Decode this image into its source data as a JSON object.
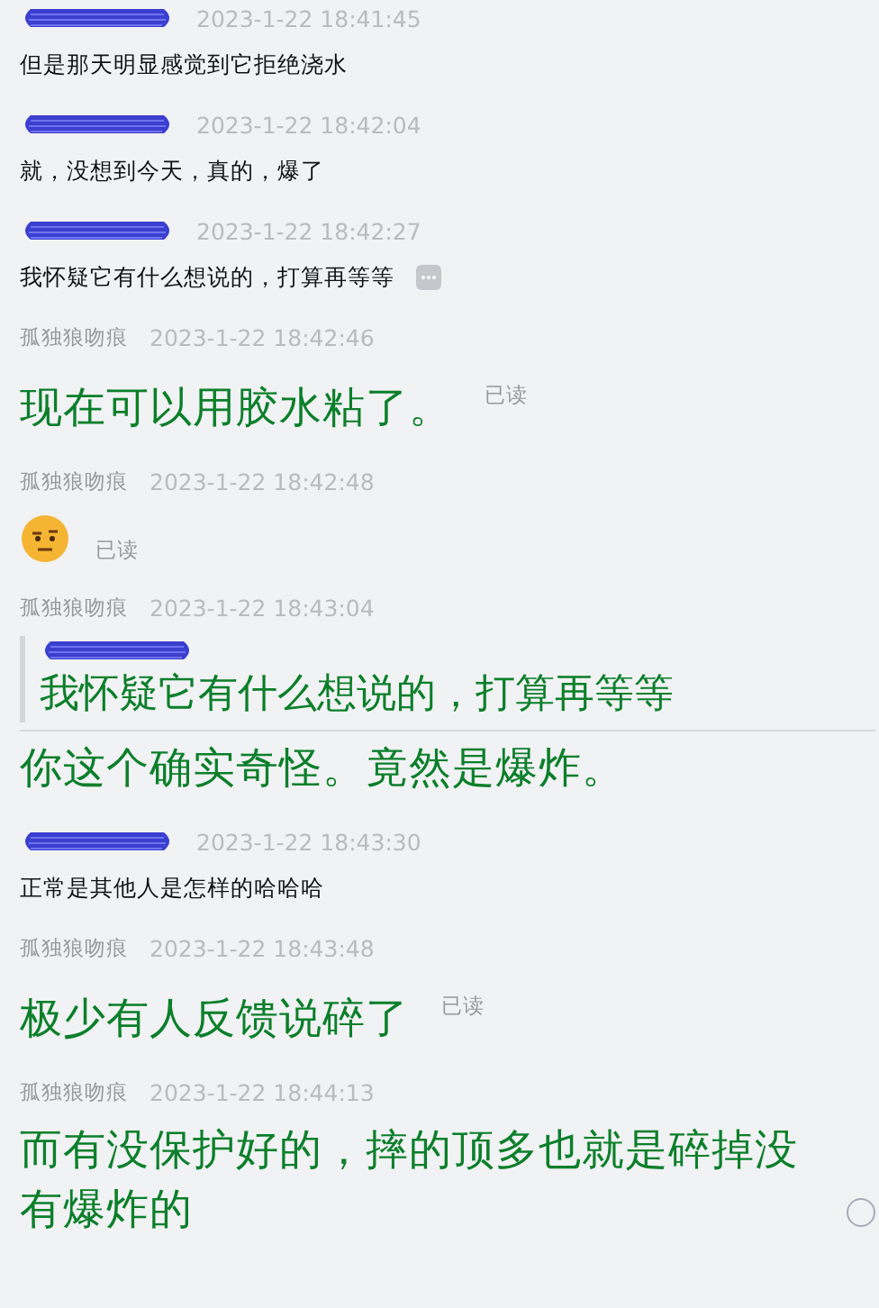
{
  "messages": [
    {
      "kind": "incoming",
      "time": "2023-1-22 18:41:45",
      "text": "但是那天明显感觉到它拒绝浇水"
    },
    {
      "kind": "incoming",
      "time": "2023-1-22 18:42:04",
      "text": "就，没想到今天，真的，爆了"
    },
    {
      "kind": "incoming",
      "time": "2023-1-22 18:42:27",
      "text": "我怀疑它有什么想说的，打算再等等",
      "more": true
    },
    {
      "kind": "outgoing",
      "sender": "孤独狼吻痕",
      "time": "2023-1-22 18:42:46",
      "text": "现在可以用胶水粘了。",
      "receipt": "已读",
      "pending": false
    },
    {
      "kind": "emoji",
      "sender": "孤独狼吻痕",
      "time": "2023-1-22 18:42:48",
      "receipt": "已读",
      "pending": false
    },
    {
      "kind": "quote",
      "sender": "孤独狼吻痕",
      "time": "2023-1-22 18:43:04",
      "quote": "我怀疑它有什么想说的，打算再等等",
      "text": "你这个确实奇怪。竟然是爆炸。",
      "pending": false
    },
    {
      "kind": "incoming",
      "time": "2023-1-22 18:43:30",
      "text": "正常是其他人是怎样的哈哈哈"
    },
    {
      "kind": "outgoing",
      "sender": "孤独狼吻痕",
      "time": "2023-1-22 18:43:48",
      "text": "极少有人反馈说碎了",
      "receipt": "已读",
      "pending": false
    },
    {
      "kind": "outgoing",
      "sender": "孤独狼吻痕",
      "time": "2023-1-22 18:44:13",
      "text": "而有没保护好的，摔的顶多也就是碎掉没有爆炸的",
      "pending": true
    }
  ]
}
